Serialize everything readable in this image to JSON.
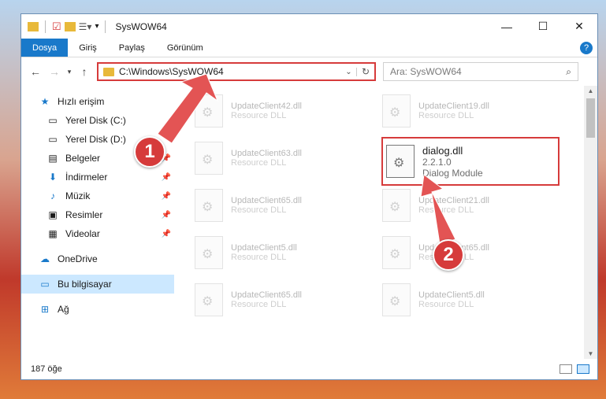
{
  "window": {
    "title": "SysWOW64"
  },
  "ribbon": {
    "tabs": [
      "Dosya",
      "Giriş",
      "Paylaş",
      "Görünüm"
    ]
  },
  "address": {
    "path": "C:\\Windows\\SysWOW64"
  },
  "search": {
    "placeholder": "Ara: SysWOW64"
  },
  "sidebar": {
    "items": [
      {
        "label": "Hızlı erişim",
        "icon": "star-icon"
      },
      {
        "label": "Yerel Disk (C:)",
        "icon": "drive-icon"
      },
      {
        "label": "Yerel Disk (D:)",
        "icon": "drive-icon"
      },
      {
        "label": "Belgeler",
        "icon": "documents-icon"
      },
      {
        "label": "İndirmeler",
        "icon": "download-icon"
      },
      {
        "label": "Müzik",
        "icon": "music-icon"
      },
      {
        "label": "Resimler",
        "icon": "pictures-icon"
      },
      {
        "label": "Videolar",
        "icon": "video-icon"
      },
      {
        "label": "OneDrive",
        "icon": "cloud-icon"
      },
      {
        "label": "Bu bilgisayar",
        "icon": "computer-icon"
      },
      {
        "label": "Ağ",
        "icon": "network-icon"
      }
    ]
  },
  "files": [
    {
      "name": "UpdateClient42.dll",
      "type": "Resource DLL"
    },
    {
      "name": "UpdateClient19.dll",
      "type": "Resource DLL"
    },
    {
      "name": "UpdateClient63.dll",
      "type": "Resource DLL"
    },
    {
      "name": "dialog.dll",
      "version": "2.2.1.0",
      "type": "Dialog Module"
    },
    {
      "name": "UpdateClient65.dll",
      "type": "Resource DLL"
    },
    {
      "name": "UpdateClient21.dll",
      "type": "Resource DLL"
    },
    {
      "name": "UpdateClient5.dll",
      "type": "Resource DLL"
    },
    {
      "name": "UpdateClient65.dll",
      "type": "Resource DLL"
    },
    {
      "name": "UpdateClient65.dll",
      "type": "Resource DLL"
    },
    {
      "name": "UpdateClient5.dll",
      "type": "Resource DLL"
    }
  ],
  "status": {
    "count": "187 öğe"
  },
  "annotations": {
    "step1": "1",
    "step2": "2",
    "color": "#d63b3b"
  }
}
